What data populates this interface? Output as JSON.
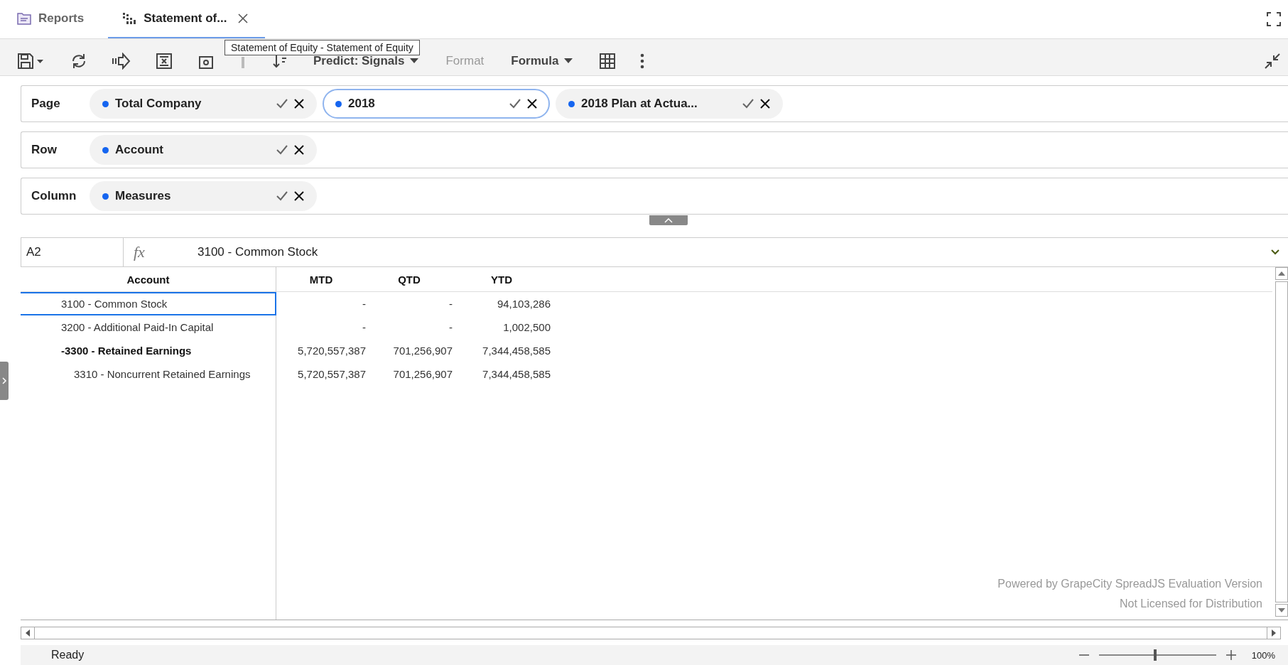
{
  "tabs": [
    {
      "label": "Reports",
      "selected": false,
      "closable": false
    },
    {
      "label": "Statement of...",
      "selected": true,
      "closable": true
    }
  ],
  "tooltip": "Statement of Equity - Statement of Equity",
  "toolbar": {
    "menus": [
      {
        "label": "Predict: Signals",
        "disabled": false,
        "dropdown": true
      },
      {
        "label": "Format",
        "disabled": true,
        "dropdown": false
      },
      {
        "label": "Formula",
        "disabled": false,
        "dropdown": true
      }
    ]
  },
  "filters": [
    {
      "label": "Page",
      "chips": [
        {
          "label": "Total Company",
          "selected": false
        },
        {
          "label": "2018",
          "selected": true
        },
        {
          "label": "2018 Plan at Actua...",
          "selected": false
        }
      ]
    },
    {
      "label": "Row",
      "chips": [
        {
          "label": "Account",
          "selected": false
        }
      ]
    },
    {
      "label": "Column",
      "chips": [
        {
          "label": "Measures",
          "selected": false
        }
      ]
    }
  ],
  "formula_bar": {
    "cell": "A2",
    "fx": "fx",
    "value": "3100 - Common Stock"
  },
  "grid": {
    "columns": [
      "Account",
      "MTD",
      "QTD",
      "YTD"
    ],
    "rows": [
      {
        "label": "3100 - Common Stock",
        "values": [
          "-",
          "-",
          "94,103,286"
        ],
        "selected": true
      },
      {
        "label": "3200 - Additional Paid-In Capital",
        "values": [
          "-",
          "-",
          "1,002,500"
        ],
        "selected": false
      },
      {
        "label": "-3300 - Retained Earnings",
        "values": [
          "5,720,557,387",
          "701,256,907",
          "7,344,458,585"
        ],
        "selected": false,
        "children": [
          {
            "label": "3310 - Noncurrent Retained Earnings",
            "values": [
              "5,720,557,387",
              "701,256,907",
              "7,344,458,585"
            ],
            "selected": false
          }
        ]
      }
    ],
    "notice": [
      "Powered by GrapeCity SpreadJS Evaluation Version",
      "Not Licensed for Distribution"
    ]
  },
  "status_bar": {
    "status": "Ready",
    "zoom": {
      "level": 0.48,
      "reading": "100%"
    }
  }
}
